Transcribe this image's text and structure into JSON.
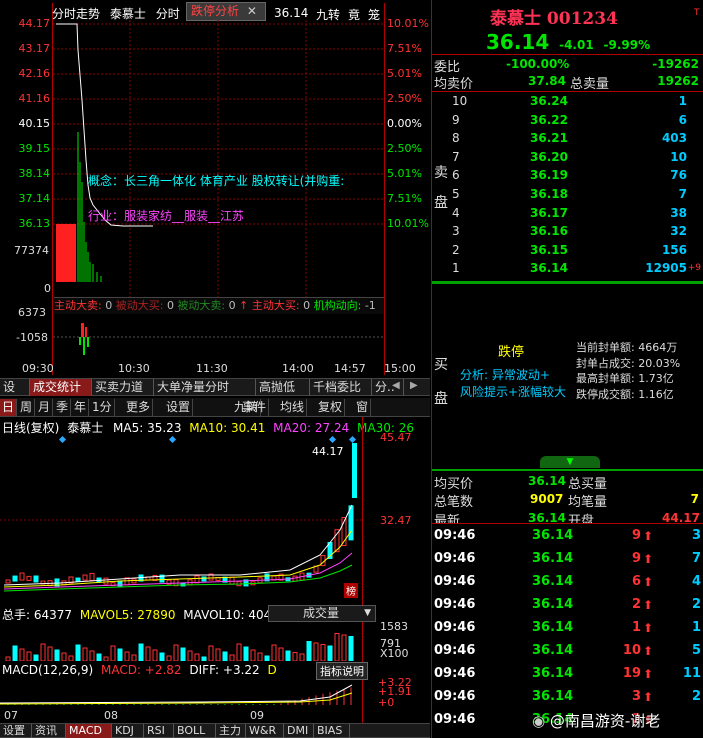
{
  "intraday": {
    "tab_label": "分时走势",
    "stock_name": "泰慕士",
    "period": "分时",
    "popup": "跌停分析",
    "popup_close": "✕",
    "price_fragment": "36.14",
    "jiuzhuan": "九转",
    "jing": "竟",
    "long": "笼",
    "y_prices": [
      "44.17",
      "43.17",
      "42.16",
      "41.16",
      "40.15",
      "39.15",
      "38.14",
      "37.14",
      "36.13"
    ],
    "y_pcts": [
      "10.01%",
      "7.51%",
      "5.01%",
      "2.50%",
      "0.00%",
      "2.50%",
      "5.01%",
      "7.51%",
      "10.01%"
    ],
    "vol_tick": "77374",
    "vol_zero": "0",
    "concept": "概念：长三角一体化  体育产业  股权转让(并购重:",
    "industry": "行业：服装家纺__服装__江苏",
    "flow_labels": [
      "主动大卖:",
      "0",
      "被动大买:",
      "0",
      "被动大卖:",
      "0",
      "↑",
      "主动大买:",
      "0",
      "机构动向:",
      "-1"
    ],
    "flow_ticks": [
      "6373",
      "-1058"
    ],
    "times": [
      "09:30",
      "10:30",
      "11:30",
      "14:00",
      "14:57",
      "15:00"
    ]
  },
  "mid_tabs": [
    "设置",
    "成交统计",
    "买卖力道",
    "大单净量分时",
    "高抛低吸",
    "千档委比",
    "分.."
  ],
  "kline_toolbar": [
    "日",
    "周",
    "月",
    "季",
    "年",
    "1分",
    "更多",
    "设置",
    "九转",
    "事件",
    "均线",
    "复权",
    "窗"
  ],
  "kline": {
    "header": {
      "label": "日线(复权)",
      "name": "泰慕士",
      "ma5": "MA5: 35.23",
      "ma10": "MA10: 30.41",
      "ma20": "MA20: 27.24",
      "ma30": "MA30: 26"
    },
    "price_high": "45.47",
    "price_mid": "32.47",
    "peak_label": "44.17",
    "bang": "榜",
    "vol_header": {
      "total": "总手: 64377",
      "mavol5": "MAVOL5: 27890",
      "mavol10": "MAVOL10: 40447",
      "select": "成交量"
    },
    "vol_ticks": [
      "1583",
      "791",
      "X100"
    ],
    "macd_header": {
      "param": "MACD(12,26,9)",
      "macd": "MACD: +2.82",
      "diff": "DIFF: +3.22",
      "d": "D",
      "btn": "指标说明"
    },
    "macd_ticks": [
      "+3.22",
      "+1.91",
      "+0"
    ],
    "months": [
      "07",
      "08",
      "09"
    ]
  },
  "bottom_tabs": [
    "设置",
    "资讯",
    "MACD",
    "KDJ",
    "RSI",
    "BOLL",
    "主力",
    "W&R",
    "DMI",
    "BIAS"
  ],
  "quote": {
    "name": "泰慕士",
    "code": "001234",
    "price": "36.14",
    "change": "-4.01",
    "pct": "-9.99%",
    "weibi_label": "委比",
    "weibi_pct": "-100.00%",
    "weibi_val": "-19262",
    "avg_sell_label": "均卖价",
    "avg_sell": "37.84",
    "total_sell_label": "总卖量",
    "total_sell": "19262",
    "sell_side_label": [
      "卖",
      "盘"
    ],
    "buy_side_label": [
      "买",
      "盘"
    ],
    "asks": [
      {
        "lvl": "10",
        "p": "36.24",
        "v": "1"
      },
      {
        "lvl": "9",
        "p": "36.22",
        "v": "6"
      },
      {
        "lvl": "8",
        "p": "36.21",
        "v": "403"
      },
      {
        "lvl": "7",
        "p": "36.20",
        "v": "10"
      },
      {
        "lvl": "6",
        "p": "36.19",
        "v": "76"
      },
      {
        "lvl": "5",
        "p": "36.18",
        "v": "7"
      },
      {
        "lvl": "4",
        "p": "36.17",
        "v": "38"
      },
      {
        "lvl": "3",
        "p": "36.16",
        "v": "32"
      },
      {
        "lvl": "2",
        "p": "36.15",
        "v": "156"
      },
      {
        "lvl": "1",
        "p": "36.14",
        "v": "12905",
        "d": "+9"
      }
    ],
    "limit_title": "跌停",
    "limit_info": [
      "当前封单额: 4664万",
      "封单占成交: 20.03%",
      "最高封单额: 1.73亿",
      "跌停成交额: 1.16亿"
    ],
    "analysis": "分析: 异常波动+",
    "risk": "风险提示+涨幅较大",
    "avg_buy_label": "均买价",
    "avg_buy": "36.14",
    "total_buy_label": "总买量",
    "total_buy": "",
    "total_count_label": "总笔数",
    "total_count": "9007",
    "avg_count_label": "均笔量",
    "avg_count": "7",
    "latest_label": "最新",
    "latest": "36.14",
    "open_label": "开盘",
    "open": "44.17",
    "ticks": [
      {
        "t": "09:46",
        "p": "36.14",
        "v": "9",
        "n": "3"
      },
      {
        "t": "09:46",
        "p": "36.14",
        "v": "9",
        "n": "7"
      },
      {
        "t": "09:46",
        "p": "36.14",
        "v": "6",
        "n": "4"
      },
      {
        "t": "09:46",
        "p": "36.14",
        "v": "2",
        "n": "2"
      },
      {
        "t": "09:46",
        "p": "36.14",
        "v": "1",
        "n": "1"
      },
      {
        "t": "09:46",
        "p": "36.14",
        "v": "10",
        "n": "5"
      },
      {
        "t": "09:46",
        "p": "36.14",
        "v": "19",
        "n": "11"
      },
      {
        "t": "09:46",
        "p": "36.14",
        "v": "3",
        "n": "2"
      },
      {
        "t": "09:46",
        "p": "36.14",
        "v": "2",
        "n": ""
      }
    ],
    "watermark": "@南昌游资-谢老"
  },
  "colors": {
    "up": "#ff3333",
    "down": "#00e600",
    "grid": "#b00000",
    "accent": "#8a1a1a"
  }
}
